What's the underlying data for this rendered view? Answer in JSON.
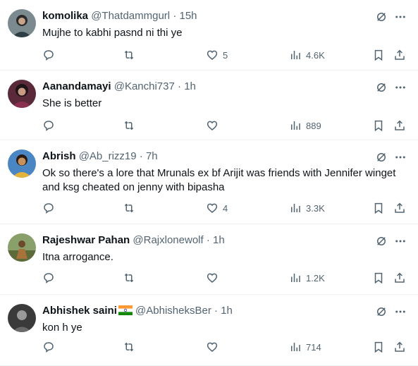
{
  "tweets": [
    {
      "name": "komolika",
      "handle": "@Thatdammgurl",
      "time": "15h",
      "text": "Mujhe to kabhi pasnd ni thi ye",
      "likes": "5",
      "views": "4.6K"
    },
    {
      "name": "Aanandamayi",
      "handle": "@Kanchi737",
      "time": "1h",
      "text": "She is better",
      "likes": "",
      "views": "889"
    },
    {
      "name": "Abrish",
      "handle": "@Ab_rizz19",
      "time": "7h",
      "text": "Ok so there's a lore that Mrunals ex bf Arijit was friends with Jennifer winget and ksg cheated on jenny with bipasha",
      "likes": "4",
      "views": "3.3K"
    },
    {
      "name": "Rajeshwar Pahan",
      "handle": "@Rajxlonewolf",
      "time": "1h",
      "text": "Itna arrogance.",
      "likes": "",
      "views": "1.2K"
    },
    {
      "name": "Abhishek saini",
      "handle": "@AbhisheksBer",
      "time": "1h",
      "text": "kon h ye",
      "likes": "",
      "views": "714"
    }
  ],
  "separator": "·",
  "icons": {
    "reply": "reply-icon",
    "retweet": "retweet-icon",
    "like": "heart-icon",
    "views": "views-icon",
    "bookmark": "bookmark-icon",
    "share": "share-icon",
    "grok": "grok-icon",
    "more": "more-icon",
    "flag": "india-flag-icon"
  },
  "colors": {
    "text": "#0f1419",
    "secondary": "#536471",
    "divider": "#eff3f4"
  }
}
